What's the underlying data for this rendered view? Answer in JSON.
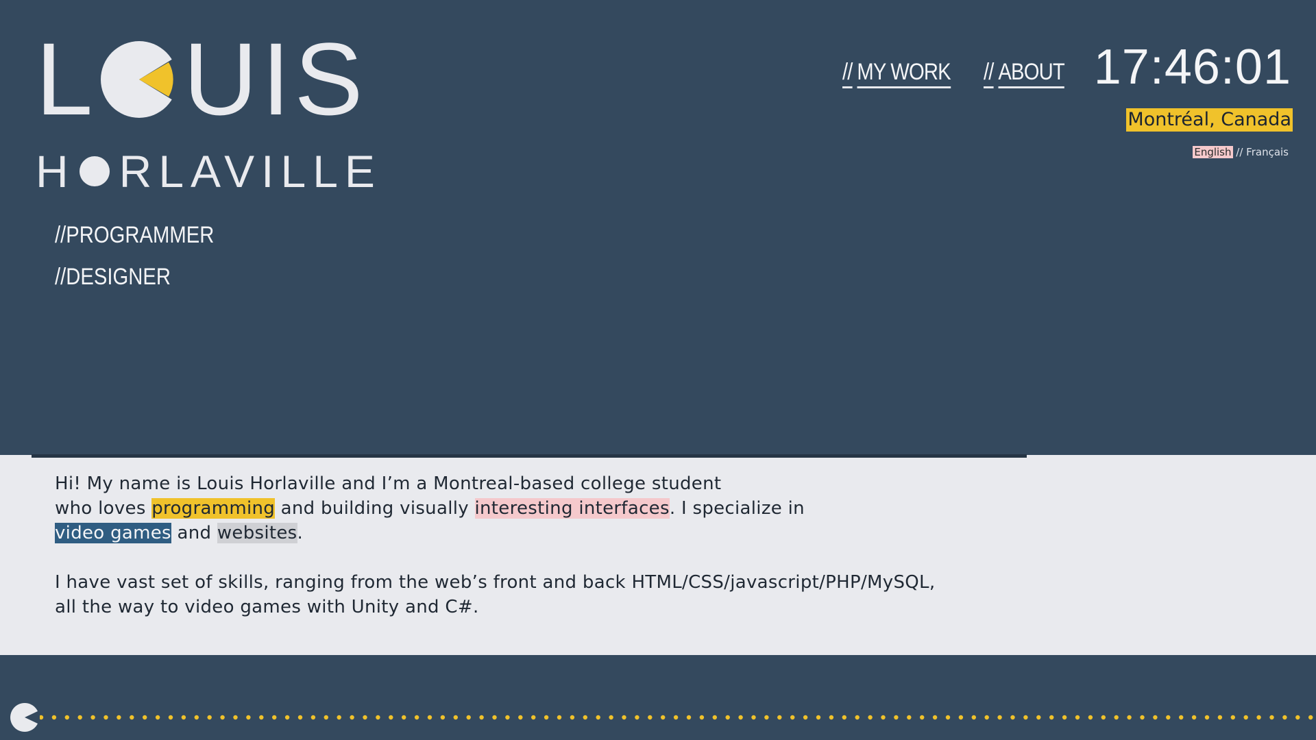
{
  "logo": {
    "first_name_l": "L",
    "first_name_rest": "UIS",
    "last_name_h": "H",
    "last_name_rest": "RLAVILLE"
  },
  "nav": {
    "items": [
      {
        "slashes": "//",
        "label": "MY WORK"
      },
      {
        "slashes": "//",
        "label": "ABOUT"
      }
    ]
  },
  "clock": {
    "time": "17:46:01"
  },
  "location": {
    "label": "Montréal, Canada"
  },
  "language": {
    "english": "English",
    "separator": " // ",
    "french": "Français"
  },
  "roles": [
    "//PROGRAMMER",
    "//DESIGNER"
  ],
  "about": {
    "p1_a": "Hi! My name is Louis Horlaville and I’m a Montreal-based college student",
    "p1_b": "who loves ",
    "hl_programming": "programming",
    "p1_c": " and building visually ",
    "hl_interfaces": "interesting interfaces",
    "p1_d": ". I specialize in",
    "hl_video_games": "video games",
    "p1_e": " and ",
    "hl_websites": "websites",
    "p1_f": ".",
    "p2_a": "I have vast set of skills, ranging from the web’s front and back HTML/CSS/javascript/PHP/MySQL,",
    "p2_b": "all the way to video games with Unity and C#."
  },
  "colors": {
    "background": "#34495e",
    "accent_yellow": "#f0c22b",
    "accent_pink": "#f5c9cc",
    "accent_blue": "#2f5d82",
    "panel": "#e9eaee"
  },
  "icons": {
    "logo_o": "pacman-icon",
    "footer": "pacman-icon",
    "dots": "pellet-dots"
  }
}
